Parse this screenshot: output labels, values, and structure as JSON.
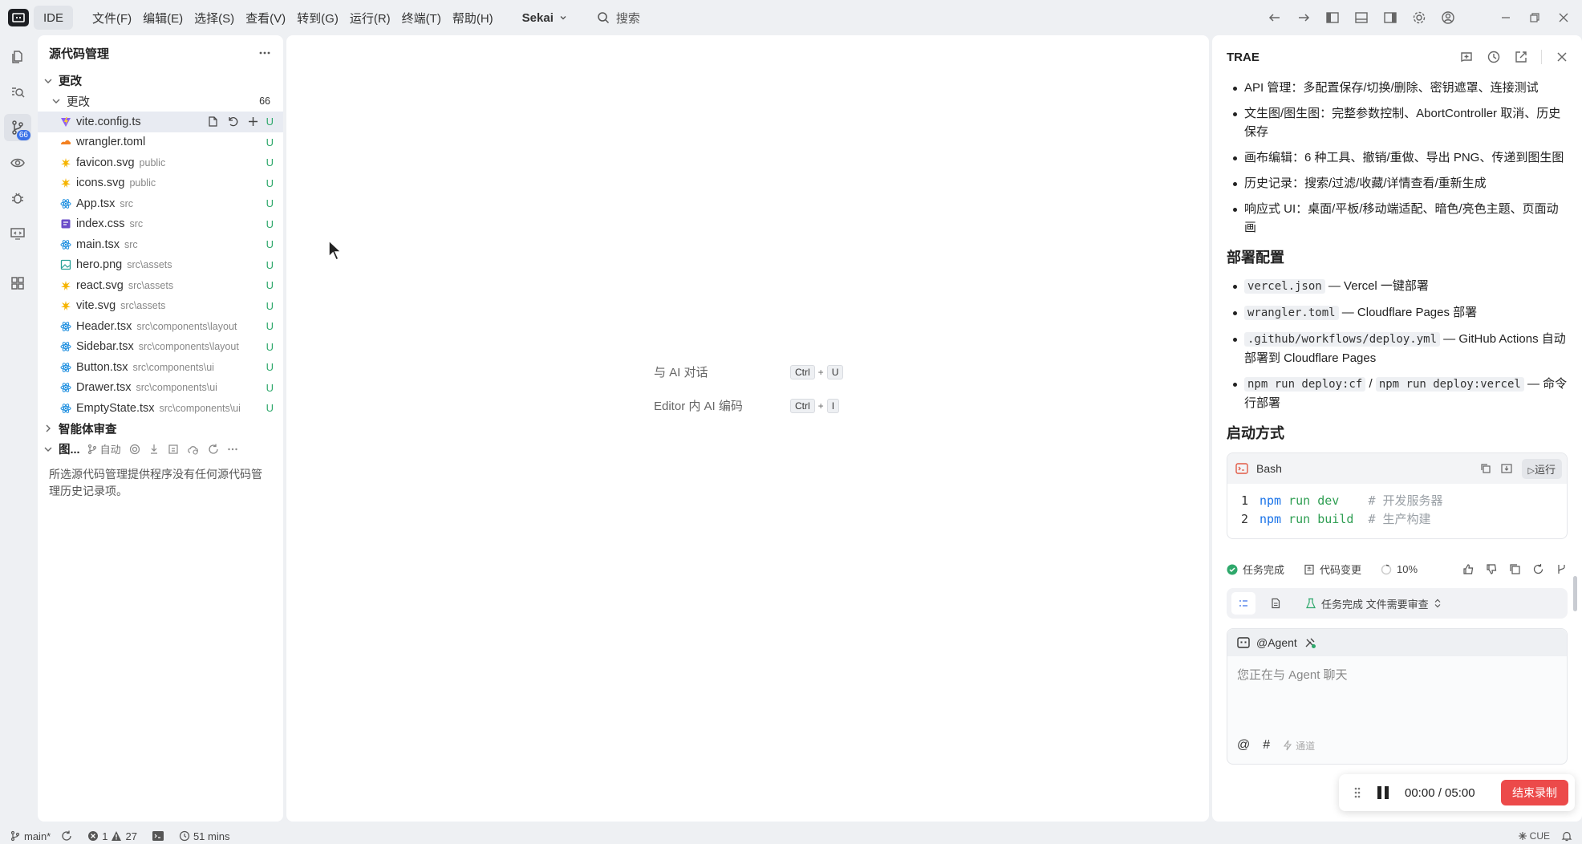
{
  "titlebar": {
    "ide_label": "IDE",
    "menus": [
      "文件(F)",
      "编辑(E)",
      "选择(S)",
      "查看(V)",
      "转到(G)",
      "运行(R)",
      "终端(T)",
      "帮助(H)"
    ],
    "project": "Sekai",
    "search_label": "搜索"
  },
  "activity": {
    "scm_badge": "66"
  },
  "scm": {
    "title": "源代码管理",
    "section_changes": "更改",
    "group_changes": "更改",
    "change_count": "66",
    "files": [
      {
        "name": "vite.config.ts",
        "path": "",
        "status": "U",
        "icon": "vite-icon",
        "color": "#8b5cf6"
      },
      {
        "name": "wrangler.toml",
        "path": "",
        "status": "U",
        "icon": "cloudflare-icon",
        "color": "#f38020"
      },
      {
        "name": "favicon.svg",
        "path": "public",
        "status": "U",
        "icon": "svg-icon",
        "color": "#f5b400"
      },
      {
        "name": "icons.svg",
        "path": "public",
        "status": "U",
        "icon": "svg-icon",
        "color": "#f5b400"
      },
      {
        "name": "App.tsx",
        "path": "src",
        "status": "U",
        "icon": "react-icon",
        "color": "#1e8fe0"
      },
      {
        "name": "index.css",
        "path": "src",
        "status": "U",
        "icon": "css-icon",
        "color": "#6a4cc9"
      },
      {
        "name": "main.tsx",
        "path": "src",
        "status": "U",
        "icon": "react-icon",
        "color": "#1e8fe0"
      },
      {
        "name": "hero.png",
        "path": "src\\assets",
        "status": "U",
        "icon": "image-icon",
        "color": "#2aa198"
      },
      {
        "name": "react.svg",
        "path": "src\\assets",
        "status": "U",
        "icon": "svg-icon",
        "color": "#f5b400"
      },
      {
        "name": "vite.svg",
        "path": "src\\assets",
        "status": "U",
        "icon": "svg-icon",
        "color": "#f5b400"
      },
      {
        "name": "Header.tsx",
        "path": "src\\components\\layout",
        "status": "U",
        "icon": "react-icon",
        "color": "#1e8fe0"
      },
      {
        "name": "Sidebar.tsx",
        "path": "src\\components\\layout",
        "status": "U",
        "icon": "react-icon",
        "color": "#1e8fe0"
      },
      {
        "name": "Button.tsx",
        "path": "src\\components\\ui",
        "status": "U",
        "icon": "react-icon",
        "color": "#1e8fe0"
      },
      {
        "name": "Drawer.tsx",
        "path": "src\\components\\ui",
        "status": "U",
        "icon": "react-icon",
        "color": "#1e8fe0"
      },
      {
        "name": "EmptyState.tsx",
        "path": "src\\components\\ui",
        "status": "U",
        "icon": "react-icon",
        "color": "#1e8fe0"
      }
    ],
    "section_review": "智能体审查",
    "graph_label": "图...",
    "graph_auto": "自动",
    "empty_message": "所选源代码管理提供程序没有任何源代码管理历史记录项。"
  },
  "editor": {
    "hints": [
      {
        "label": "与 AI 对话",
        "key1": "Ctrl",
        "key2": "U"
      },
      {
        "label": "Editor 内 AI 编码",
        "key1": "Ctrl",
        "key2": "I"
      }
    ],
    "plus": "+"
  },
  "trae": {
    "title": "TRAE",
    "features": [
      "API 管理：多配置保存/切换/删除、密钥遮罩、连接测试",
      "文生图/图生图：完整参数控制、AbortController 取消、历史保存",
      "画布编辑：6 种工具、撤销/重做、导出 PNG、传递到图生图",
      "历史记录：搜索/过滤/收藏/详情查看/重新生成",
      "响应式 UI：桌面/平板/移动端适配、暗色/亮色主题、页面动画"
    ],
    "deploy_heading": "部署配置",
    "deploy": [
      {
        "code": "vercel.json",
        "text": " — Vercel 一键部署"
      },
      {
        "code": "wrangler.toml",
        "text": " — Cloudflare Pages 部署"
      },
      {
        "code": ".github/workflows/deploy.yml",
        "text": " — GitHub Actions 自动部署到 Cloudflare Pages"
      }
    ],
    "deploy_cmd": {
      "code1": "npm run deploy:cf",
      "sep": " / ",
      "code2": "npm run deploy:vercel",
      "text": " — 命令行部署"
    },
    "start_heading": "启动方式",
    "code_lang": "Bash",
    "run_label": "运行",
    "code_lines": [
      {
        "n": "1",
        "cmd": "npm",
        "sub": "run dev",
        "pad": "    ",
        "comment": "# 开发服务器"
      },
      {
        "n": "2",
        "cmd": "npm",
        "sub": "run build",
        "pad": "  ",
        "comment": "# 生产构建"
      }
    ],
    "status": {
      "done": "任务完成",
      "changes": "代码变更",
      "progress": "10%"
    },
    "task_summary": "任务完成 文件需要审查",
    "agent_label": "@Agent",
    "chat_placeholder": "您正在与 Agent 聊天",
    "chat_at": "@",
    "chat_hash": "#",
    "chat_mode": "通道"
  },
  "recorder": {
    "time": "00:00 / 05:00",
    "stop_label": "结束录制"
  },
  "statusbar": {
    "branch": "main*",
    "errors": "1",
    "warnings": "27",
    "time": "51 mins",
    "lang": "CUE"
  }
}
